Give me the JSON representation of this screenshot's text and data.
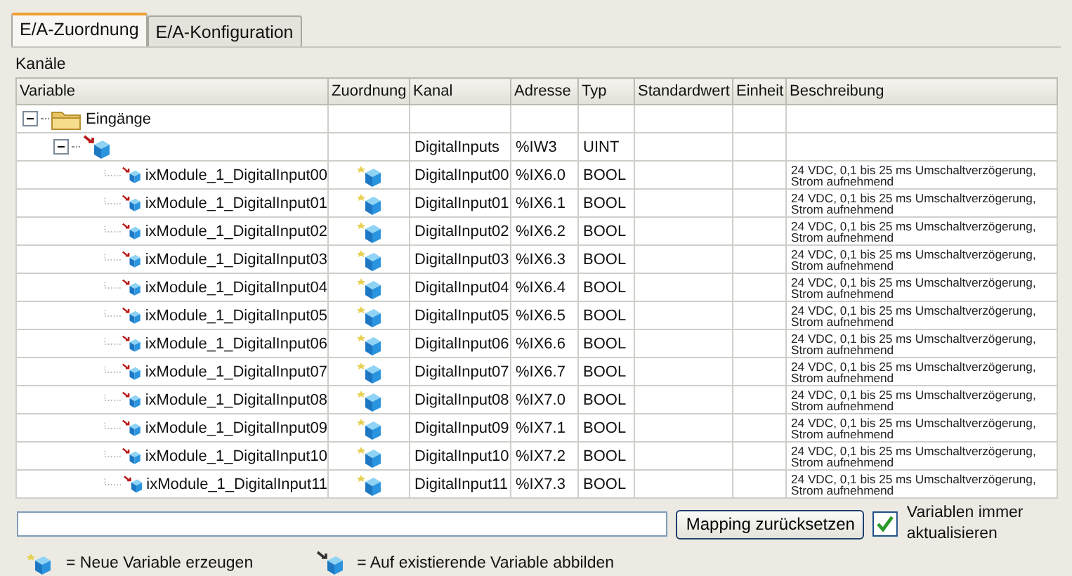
{
  "tabs": [
    {
      "label": "E/A-Zuordnung",
      "selected": true
    },
    {
      "label": "E/A-Konfiguration",
      "selected": false
    }
  ],
  "section_title": "Kanäle",
  "table": {
    "columns": [
      "Variable",
      "Zuordnung",
      "Kanal",
      "Adresse",
      "Typ",
      "Standardwert",
      "Einheit",
      "Beschreibung"
    ],
    "rows": [
      {
        "kind": "folder",
        "variable": "Eingänge",
        "expanded": true,
        "children": [
          {
            "kind": "module",
            "expanded": true,
            "channel": "DigitalInputs",
            "address": "%IW3",
            "type": "UINT",
            "children": [
              {
                "kind": "channel",
                "variable": "ixModule_1_DigitalInput00",
                "channel": "DigitalInput00",
                "address": "%IX6.0",
                "type": "BOOL",
                "description": "24 VDC, 0,1 bis 25 ms Umschaltverzögerung, Strom aufnehmend"
              },
              {
                "kind": "channel",
                "variable": "ixModule_1_DigitalInput01",
                "channel": "DigitalInput01",
                "address": "%IX6.1",
                "type": "BOOL",
                "description": "24 VDC, 0,1 bis 25 ms Umschaltverzögerung, Strom aufnehmend"
              },
              {
                "kind": "channel",
                "variable": "ixModule_1_DigitalInput02",
                "channel": "DigitalInput02",
                "address": "%IX6.2",
                "type": "BOOL",
                "description": "24 VDC, 0,1 bis 25 ms Umschaltverzögerung, Strom aufnehmend"
              },
              {
                "kind": "channel",
                "variable": "ixModule_1_DigitalInput03",
                "channel": "DigitalInput03",
                "address": "%IX6.3",
                "type": "BOOL",
                "description": "24 VDC, 0,1 bis 25 ms Umschaltverzögerung, Strom aufnehmend"
              },
              {
                "kind": "channel",
                "variable": "ixModule_1_DigitalInput04",
                "channel": "DigitalInput04",
                "address": "%IX6.4",
                "type": "BOOL",
                "description": "24 VDC, 0,1 bis 25 ms Umschaltverzögerung, Strom aufnehmend"
              },
              {
                "kind": "channel",
                "variable": "ixModule_1_DigitalInput05",
                "channel": "DigitalInput05",
                "address": "%IX6.5",
                "type": "BOOL",
                "description": "24 VDC, 0,1 bis 25 ms Umschaltverzögerung, Strom aufnehmend"
              },
              {
                "kind": "channel",
                "variable": "ixModule_1_DigitalInput06",
                "channel": "DigitalInput06",
                "address": "%IX6.6",
                "type": "BOOL",
                "description": "24 VDC, 0,1 bis 25 ms Umschaltverzögerung, Strom aufnehmend"
              },
              {
                "kind": "channel",
                "variable": "ixModule_1_DigitalInput07",
                "channel": "DigitalInput07",
                "address": "%IX6.7",
                "type": "BOOL",
                "description": "24 VDC, 0,1 bis 25 ms Umschaltverzögerung, Strom aufnehmend"
              },
              {
                "kind": "channel",
                "variable": "ixModule_1_DigitalInput08",
                "channel": "DigitalInput08",
                "address": "%IX7.0",
                "type": "BOOL",
                "description": "24 VDC, 0,1 bis 25 ms Umschaltverzögerung, Strom aufnehmend"
              },
              {
                "kind": "channel",
                "variable": "ixModule_1_DigitalInput09",
                "channel": "DigitalInput09",
                "address": "%IX7.1",
                "type": "BOOL",
                "description": "24 VDC, 0,1 bis 25 ms Umschaltverzögerung, Strom aufnehmend"
              },
              {
                "kind": "channel",
                "variable": "ixModule_1_DigitalInput10",
                "channel": "DigitalInput10",
                "address": "%IX7.2",
                "type": "BOOL",
                "description": "24 VDC, 0,1 bis 25 ms Umschaltverzögerung, Strom aufnehmend"
              },
              {
                "kind": "channel",
                "variable": "ixModule_1_DigitalInput11",
                "channel": "DigitalInput11",
                "address": "%IX7.3",
                "type": "BOOL",
                "description": "24 VDC, 0,1 bis 25 ms Umschaltverzögerung, Strom aufnehmend"
              }
            ]
          }
        ]
      }
    ]
  },
  "reset_button": "Mapping zurücksetzen",
  "always_update": {
    "label": "Variablen immer aktualisieren",
    "checked": true
  },
  "legend": [
    {
      "kind": "new",
      "text": "= Neue Variable erzeugen"
    },
    {
      "kind": "existing",
      "text": "= Auf existierende Variable abbilden"
    }
  ]
}
